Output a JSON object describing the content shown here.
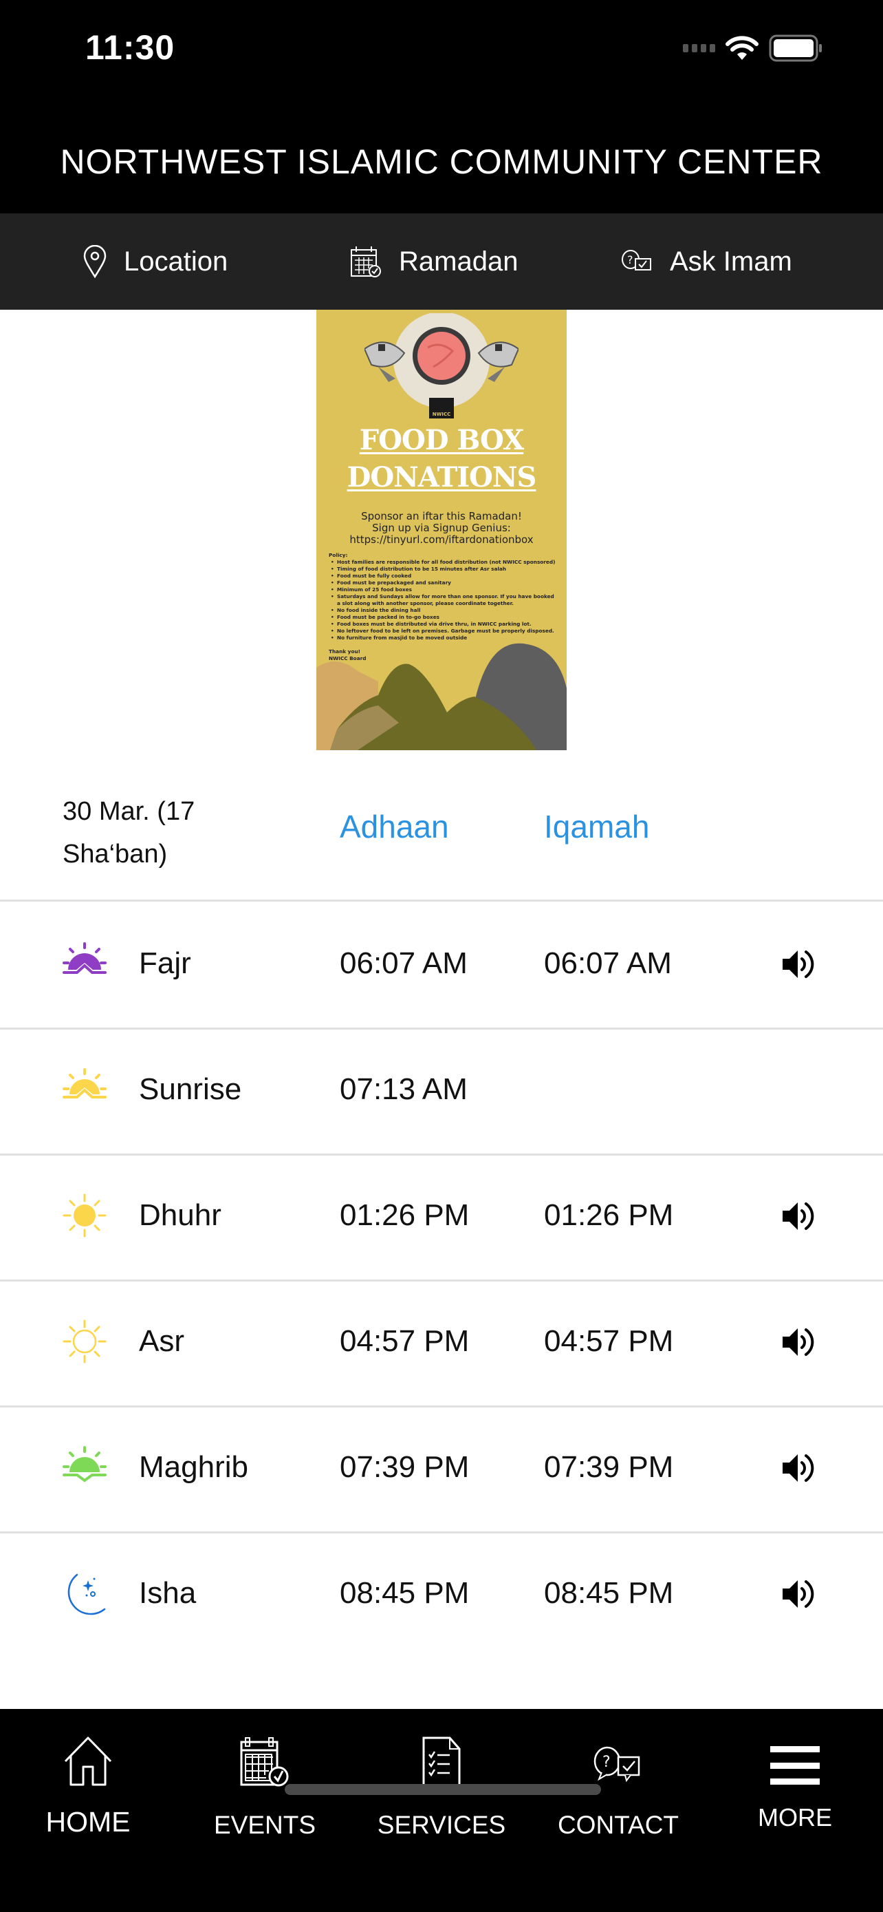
{
  "status_bar": {
    "time": "11:30"
  },
  "header": {
    "title": "NORTHWEST ISLAMIC COMMUNITY CENTER"
  },
  "quick_nav": [
    {
      "label": "Location",
      "icon": "location-pin-icon"
    },
    {
      "label": "Ramadan",
      "icon": "calendar-check-icon"
    },
    {
      "label": "Ask Imam",
      "icon": "question-chat-icon"
    }
  ],
  "banner": {
    "title_line1": "FOOD BOX",
    "title_line2": "DONATIONS",
    "org_logo": "NWICC",
    "sponsor_lines": [
      "Sponsor an iftar this Ramadan!",
      "Sign up via Signup Genius:",
      "https://tinyurl.com/iftardonationbox"
    ],
    "policy_heading": "Policy:",
    "policy_items": [
      "Host families are responsible for all food distribution (not NWICC sponsored)",
      "Timing of food distribution to be 15 minutes after Asr salah",
      "Food must be fully cooked",
      "Food must be prepackaged and sanitary",
      "Minimum of 25 food boxes",
      "Saturdays and Sundays allow for more than one sponsor. If you have booked a slot along with another sponsor, please coordinate together.",
      "No food inside the dining hall",
      "Food must be packed in to-go boxes",
      "Food boxes must be distributed via drive thru, in NWICC parking lot.",
      "No leftover food to be left on premises. Garbage must be properly disposed.",
      "No furniture from masjid to be moved outside"
    ],
    "thanks_line1": "Thank you!",
    "thanks_line2": "NWICC Board"
  },
  "prayer_table": {
    "date": "30 Mar. (17 Sha‘ban)",
    "col_adhaan": "Adhaan",
    "col_iqamah": "Iqamah",
    "accent_color": "#2a92e0",
    "rows": [
      {
        "name": "Fajr",
        "adhaan": "06:07 AM",
        "iqamah": "06:07 AM",
        "icon": "dawn-sun-icon",
        "color": "#8e3dc4",
        "speaker": true
      },
      {
        "name": "Sunrise",
        "adhaan": "07:13 AM",
        "iqamah": "",
        "icon": "sunrise-icon",
        "color": "#fbd54a",
        "speaker": false
      },
      {
        "name": "Dhuhr",
        "adhaan": "01:26 PM",
        "iqamah": "01:26 PM",
        "icon": "sun-filled-icon",
        "color": "#fbd54a",
        "speaker": true
      },
      {
        "name": "Asr",
        "adhaan": "04:57 PM",
        "iqamah": "04:57 PM",
        "icon": "sun-outline-icon",
        "color": "#fbd54a",
        "speaker": true
      },
      {
        "name": "Maghrib",
        "adhaan": "07:39 PM",
        "iqamah": "07:39 PM",
        "icon": "sunset-icon",
        "color": "#7ed957",
        "speaker": true
      },
      {
        "name": "Isha",
        "adhaan": "08:45 PM",
        "iqamah": "08:45 PM",
        "icon": "moon-stars-icon",
        "color": "#1a6fd6",
        "speaker": true
      }
    ]
  },
  "tab_bar": [
    {
      "label": "HOME",
      "icon": "home-icon",
      "active": true
    },
    {
      "label": "EVENTS",
      "icon": "calendar-icon",
      "active": false
    },
    {
      "label": "SERVICES",
      "icon": "checklist-icon",
      "active": false
    },
    {
      "label": "CONTACT",
      "icon": "chat-question-icon",
      "active": false
    },
    {
      "label": "MORE",
      "icon": "menu-icon",
      "active": false
    }
  ]
}
